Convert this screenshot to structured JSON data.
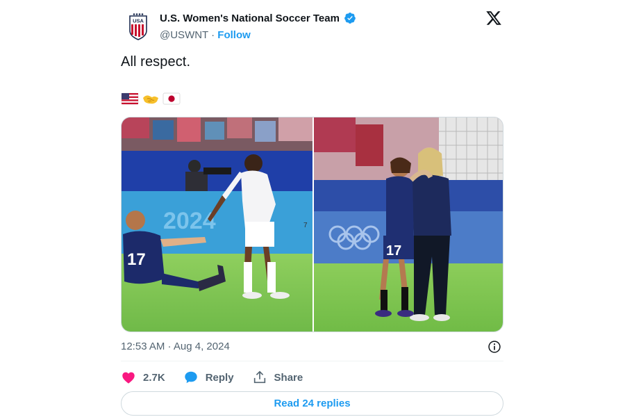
{
  "account": {
    "display_name": "U.S. Women's National Soccer Team",
    "handle": "@USWNT",
    "separator": "·",
    "follow_label": "Follow",
    "avatar_text": "USA",
    "verified": true
  },
  "tweet": {
    "text": "All respect.",
    "emojis": [
      "us-flag-emoji",
      "handshake-emoji",
      "japan-flag-emoji"
    ],
    "timestamp": "12:53 AM · Aug 4, 2024"
  },
  "media": {
    "count": 2,
    "left_photo_jersey_number": "17",
    "right_photo_jersey_number": "17",
    "left_photo_board_text": "2024"
  },
  "actions": {
    "like_count": "2.7K",
    "reply_label": "Reply",
    "share_label": "Share"
  },
  "read_replies_label": "Read 24 replies",
  "colors": {
    "accent": "#1d9bf0",
    "text_primary": "#0f1419",
    "text_secondary": "#536471",
    "like": "#f91880",
    "border": "#cfd9de"
  },
  "icons": {
    "brand": "x-logo-icon",
    "verified": "verified-badge-icon",
    "info": "info-icon",
    "like": "heart-icon",
    "reply": "chat-bubble-icon",
    "share": "share-upload-icon"
  }
}
